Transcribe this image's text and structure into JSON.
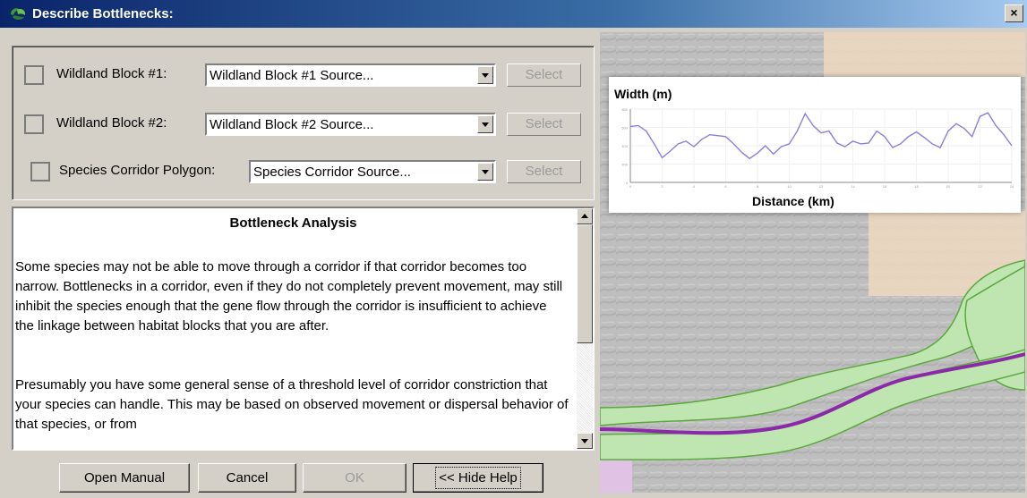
{
  "window": {
    "title": "Describe Bottlenecks:",
    "close_label": "×"
  },
  "selectors": [
    {
      "label": "Wildland Block #1:",
      "combo_value": "Wildland Block #1 Source...",
      "button": "Select",
      "checked": false
    },
    {
      "label": "Wildland Block #2:",
      "combo_value": "Wildland Block #2 Source...",
      "button": "Select",
      "checked": false
    },
    {
      "label": "Species Corridor Polygon:",
      "combo_value": "Species Corridor Source...",
      "button": "Select",
      "checked": false
    }
  ],
  "help": {
    "heading": "Bottleneck Analysis",
    "paragraphs": [
      "Some species may not be able to move through a corridor if that corridor becomes too narrow.  Bottlenecks in a corridor, even if they do not completely prevent movement, may still inhibit the species enough that the gene flow through the corridor is insufficient to achieve the linkage between habitat blocks that you are after.",
      "Presumably you have some general sense of a threshold level of corridor constriction that your species can handle.  This may be based on observed movement or dispersal behavior of that species, or from"
    ]
  },
  "buttons": {
    "open_manual": "Open Manual",
    "cancel": "Cancel",
    "ok": "OK",
    "hide_help": "<< Hide Help"
  },
  "chart_data": {
    "type": "line",
    "ylabel": "Width (m)",
    "xlabel": "Distance (km)",
    "xlim": [
      0,
      24
    ],
    "ylim": [
      0,
      800
    ],
    "x_ticks": [
      0,
      2,
      4,
      6,
      8,
      10,
      12,
      14,
      16,
      18,
      20,
      22,
      24
    ],
    "y_ticks": [
      0,
      200,
      400,
      600,
      800
    ],
    "series": [
      {
        "color": "#8a80d8",
        "x": [
          0,
          0.5,
          1,
          1.5,
          2,
          2.5,
          3,
          3.5,
          4,
          4.5,
          5,
          5.5,
          6,
          6.5,
          7,
          7.5,
          8,
          8.5,
          9,
          9.5,
          10,
          10.5,
          11,
          11.5,
          12,
          12.5,
          13,
          13.5,
          14,
          14.5,
          15,
          15.5,
          16,
          16.5,
          17,
          17.5,
          18,
          18.5,
          19,
          19.5,
          20,
          20.5,
          21,
          21.5,
          22,
          22.5,
          23,
          23.5,
          24
        ],
        "y": [
          610,
          620,
          560,
          420,
          270,
          340,
          420,
          450,
          390,
          470,
          520,
          510,
          500,
          420,
          330,
          260,
          320,
          400,
          310,
          390,
          420,
          560,
          750,
          620,
          540,
          560,
          430,
          390,
          450,
          420,
          430,
          560,
          500,
          380,
          420,
          500,
          550,
          490,
          420,
          380,
          560,
          640,
          590,
          500,
          720,
          760,
          620,
          520,
          400
        ]
      }
    ]
  }
}
